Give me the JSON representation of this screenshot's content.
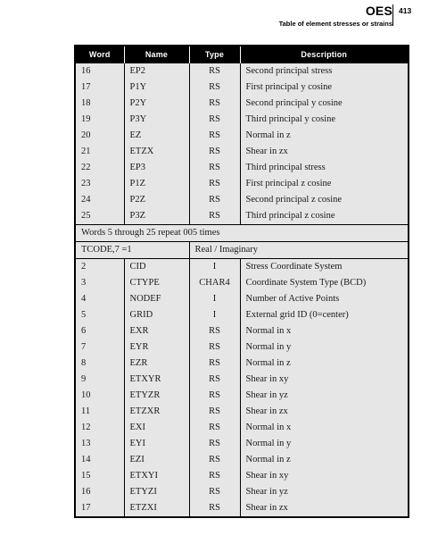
{
  "header": {
    "title": "OES",
    "subtitle": "Table of element stresses or strains",
    "page_number": "413"
  },
  "table": {
    "columns": [
      "Word",
      "Name",
      "Type",
      "Description"
    ],
    "rows": [
      {
        "word": "16",
        "name": "EP2",
        "type": "RS",
        "description": "Second principal stress"
      },
      {
        "word": "17",
        "name": "P1Y",
        "type": "RS",
        "description": "First principal y cosine"
      },
      {
        "word": "18",
        "name": "P2Y",
        "type": "RS",
        "description": "Second principal y cosine"
      },
      {
        "word": "19",
        "name": "P3Y",
        "type": "RS",
        "description": "Third principal y cosine"
      },
      {
        "word": "20",
        "name": "EZ",
        "type": "RS",
        "description": "Normal in z"
      },
      {
        "word": "21",
        "name": "ETZX",
        "type": "RS",
        "description": "Shear in zx"
      },
      {
        "word": "22",
        "name": "EP3",
        "type": "RS",
        "description": "Third principal stress"
      },
      {
        "word": "23",
        "name": "P1Z",
        "type": "RS",
        "description": "First principal z cosine"
      },
      {
        "word": "24",
        "name": "P2Z",
        "type": "RS",
        "description": "Second principal z cosine"
      },
      {
        "word": "25",
        "name": "P3Z",
        "type": "RS",
        "description": "Third principal z cosine"
      }
    ],
    "repeat_note": "Words 5 through 25 repeat 005 times",
    "tcode_row": {
      "condition": "TCODE,7 =1",
      "value": "Real / Imaginary"
    },
    "rows2": [
      {
        "word": "2",
        "name": "CID",
        "type": "I",
        "description": "Stress Coordinate System"
      },
      {
        "word": "3",
        "name": "CTYPE",
        "type": "CHAR4",
        "description": "Coordinate System Type (BCD)"
      },
      {
        "word": "4",
        "name": "NODEF",
        "type": "I",
        "description": "Number of Active Points"
      },
      {
        "word": "5",
        "name": "GRID",
        "type": "I",
        "description": "External grid ID (0=center)"
      },
      {
        "word": "6",
        "name": "EXR",
        "type": "RS",
        "description": "Normal in x"
      },
      {
        "word": "7",
        "name": "EYR",
        "type": "RS",
        "description": "Normal in y"
      },
      {
        "word": "8",
        "name": "EZR",
        "type": "RS",
        "description": "Normal in z"
      },
      {
        "word": "9",
        "name": "ETXYR",
        "type": "RS",
        "description": "Shear in xy"
      },
      {
        "word": "10",
        "name": "ETYZR",
        "type": "RS",
        "description": "Shear in yz"
      },
      {
        "word": "11",
        "name": "ETZXR",
        "type": "RS",
        "description": "Shear in zx"
      },
      {
        "word": "12",
        "name": "EXI",
        "type": "RS",
        "description": "Normal in x"
      },
      {
        "word": "13",
        "name": "EYI",
        "type": "RS",
        "description": "Normal in y"
      },
      {
        "word": "14",
        "name": "EZI",
        "type": "RS",
        "description": "Normal in z"
      },
      {
        "word": "15",
        "name": "ETXYI",
        "type": "RS",
        "description": "Shear in xy"
      },
      {
        "word": "16",
        "name": "ETYZI",
        "type": "RS",
        "description": "Shear in yz"
      },
      {
        "word": "17",
        "name": "ETZXI",
        "type": "RS",
        "description": "Shear in zx"
      }
    ]
  }
}
